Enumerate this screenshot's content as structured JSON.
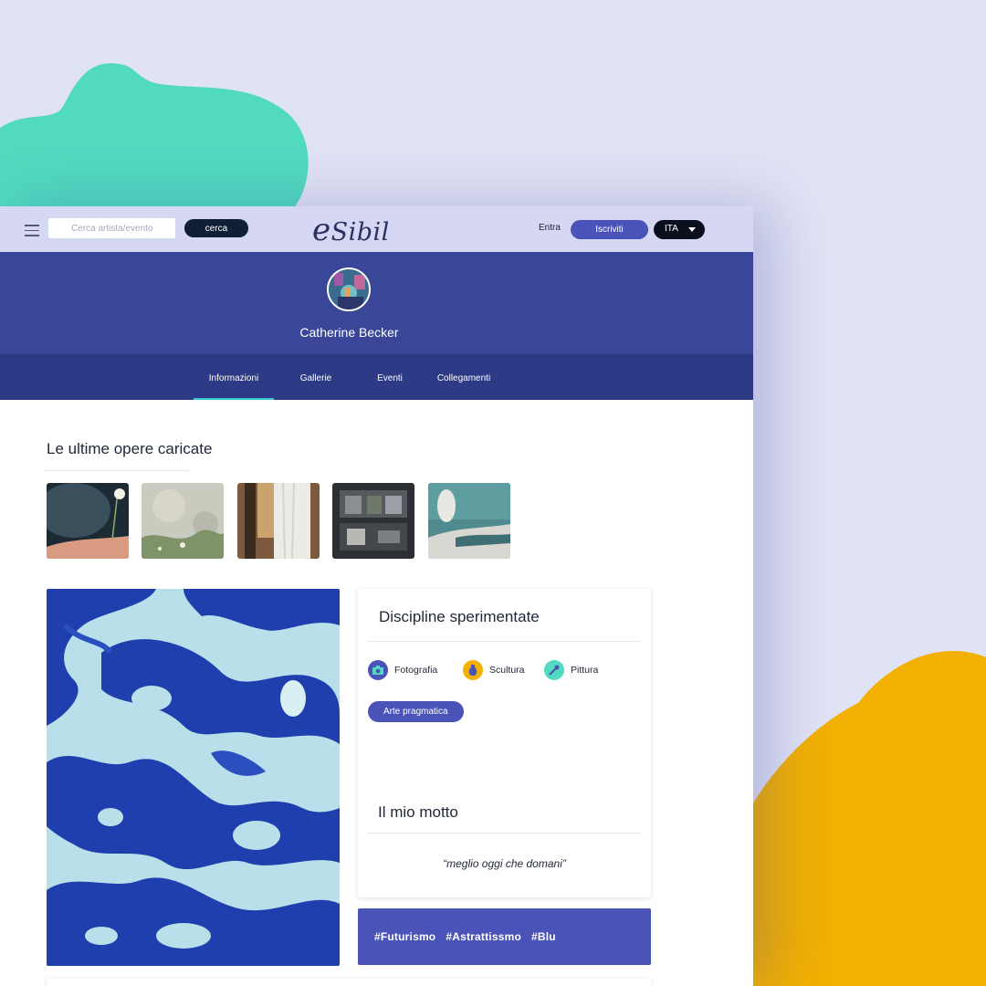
{
  "colors": {
    "background": "#e0e2f5",
    "blob_green": "#51dac0",
    "blob_yellow": "#f2b003",
    "topbar": "#d6d8f3",
    "header": "#3a4799",
    "tabs": "#2d3a86",
    "accent": "#4a53b8",
    "tab_indicator": "#38c7d6"
  },
  "topbar": {
    "menu_icon": "hamburger-icon",
    "search_placeholder": "Cerca artista/evento",
    "search_button": "cerca",
    "logo_initial": "e",
    "logo_rest": "Sibil",
    "login": "Entra",
    "signup": "Iscriviti",
    "language": "ITA",
    "language_icon": "caret-down-icon"
  },
  "profile": {
    "name": "Catherine Becker"
  },
  "tabs": [
    {
      "label": "Informazioni",
      "active": true
    },
    {
      "label": "Gallerie",
      "active": false
    },
    {
      "label": "Eventi",
      "active": false
    },
    {
      "label": "Collegamenti",
      "active": false
    }
  ],
  "latest_works": {
    "title": "Le ultime opere caricate"
  },
  "disciplines": {
    "title": "Discipline sperimentate",
    "items": [
      {
        "label": "Fotografia",
        "icon": "camera-icon",
        "color": "#4a53b8"
      },
      {
        "label": "Scultura",
        "icon": "vase-icon",
        "color": "#f2b003"
      },
      {
        "label": "Pittura",
        "icon": "paint-palette-icon",
        "color": "#51dac0"
      }
    ],
    "chip": "Arte pragmatica"
  },
  "motto": {
    "title": "Il mio motto",
    "text": "“meglio oggi che domani”"
  },
  "tags": [
    "#Futurismo",
    "#Astrattissmo",
    "#Blu"
  ]
}
